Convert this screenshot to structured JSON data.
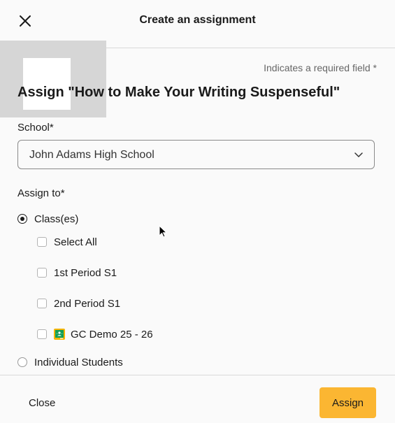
{
  "header": {
    "title": "Create an assignment",
    "close_icon": "close-icon"
  },
  "form": {
    "required_note": "Indicates a required field *",
    "assign_title": "Assign \"How to Make Your Writing Suspenseful\"",
    "school": {
      "label": "School*",
      "value": "John Adams High School"
    },
    "assign_to": {
      "label": "Assign to*",
      "options": [
        {
          "label": "Class(es)",
          "selected": true
        },
        {
          "label": "Individual Students",
          "selected": false
        }
      ],
      "classes": [
        {
          "label": "Select All",
          "checked": false,
          "icon": ""
        },
        {
          "label": "1st Period S1",
          "checked": false,
          "icon": ""
        },
        {
          "label": "2nd Period S1",
          "checked": false,
          "icon": ""
        },
        {
          "label": "GC Demo 25 - 26",
          "checked": false,
          "icon": "google-classroom-icon"
        }
      ]
    }
  },
  "footer": {
    "close_label": "Close",
    "assign_label": "Assign"
  },
  "colors": {
    "accent": "#fbb632",
    "background": "#fafafa",
    "thumbnail": "#d6d6d6"
  }
}
